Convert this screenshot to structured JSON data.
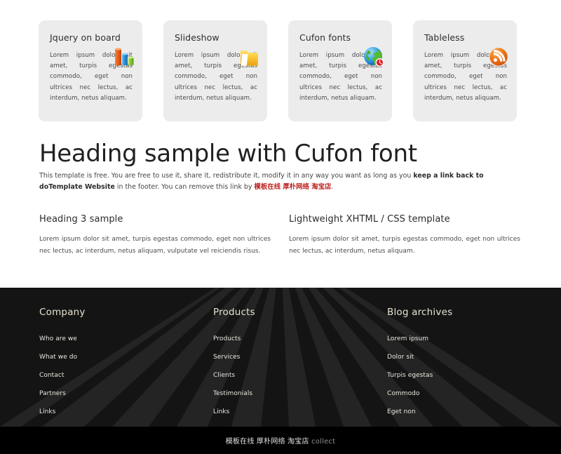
{
  "cards": [
    {
      "title": "Jquery on board",
      "text": "Lorem ipsum dolor sit amet, turpis egestas commodo, eget non ultrices nec lectus, ac interdum, netus aliquam.",
      "icon": "bar-chart-icon"
    },
    {
      "title": "Slideshow",
      "text": "Lorem ipsum dolor sit amet, turpis egestas commodo, eget non ultrices nec lectus, ac interdum, netus aliquam.",
      "icon": "folder-icon"
    },
    {
      "title": "Cufon fonts",
      "text": "Lorem ipsum dolor sit amet, turpis egestas commodo, eget non ultrices nec lectus, ac interdum, netus aliquam.",
      "icon": "globe-icon"
    },
    {
      "title": "Tableless",
      "text": "Lorem ipsum dolor sit amet, turpis egestas commodo, eget non ultrices nec lectus, ac interdum, netus aliquam.",
      "icon": "rss-icon"
    }
  ],
  "main": {
    "heading": "Heading sample with Cufon font",
    "intro_part1": "This template is free. You are free to use it, share it, redistribute it, modify it in any way you want as long as you ",
    "intro_bold": "keep a link back to doTemplate Website",
    "intro_part2": " in the footer. You can remove this link by ",
    "intro_link_cn": "模板在线 厚朴网络 淘宝店",
    "intro_part3": "."
  },
  "columns": [
    {
      "heading": "Heading 3 sample",
      "text": "Lorem ipsum dolor sit amet, turpis egestas commodo, eget non ultrices nec lectus, ac interdum, netus aliquam, vulputate vel reiciendis risus."
    },
    {
      "heading": "Lightweight XHTML / CSS template",
      "text": "Lorem ipsum dolor sit amet, turpis egestas commodo, eget non ultrices nec lectus, ac interdum, netus aliquam."
    }
  ],
  "footer": {
    "columns": [
      {
        "heading": "Company",
        "links": [
          "Who are we",
          "What we do",
          "Contact",
          "Partners",
          "Links"
        ]
      },
      {
        "heading": "Products",
        "links": [
          "Products",
          "Services",
          "Clients",
          "Testimonials",
          "Links"
        ]
      },
      {
        "heading": "Blog archives",
        "links": [
          "Lorem ipsum",
          "Dolor sit",
          "Turpis egestas",
          "Commodo",
          "Eget non"
        ]
      }
    ]
  },
  "bottombar": {
    "cn_text": "模板在线 厚朴网络 淘宝店",
    "en_text": "collect"
  },
  "colors": {
    "page_bg": "#ffffff",
    "card_bg": "#ececec",
    "footer_bg": "#141414",
    "bottombar_bg": "#000000",
    "footer_heading": "#e7e2cf",
    "link_red": "#c0231f",
    "heading_text": "#212121"
  }
}
